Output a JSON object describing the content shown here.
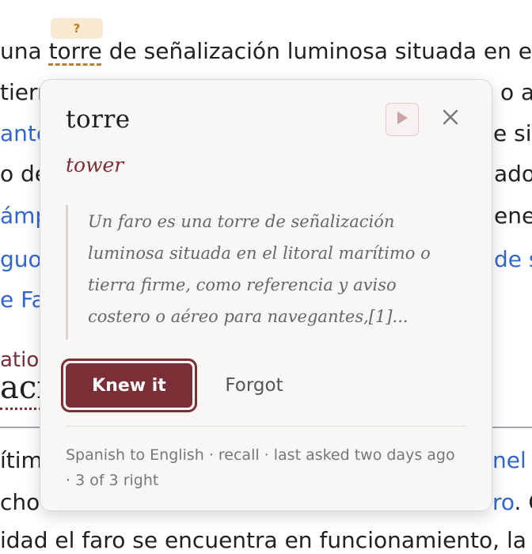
{
  "article": {
    "line1_pre": "una ",
    "line1_word": "torre",
    "line1_post": " de señalización luminosa situada en e",
    "line2_left": "tierr",
    "line2_right": "o a",
    "line3_left": "ante",
    "line3_right": "e sir",
    "line4_left": "o de",
    "line4_right": "ado",
    "line5_left": "ámp",
    "line5_right": "ene",
    "line6_left": "guo",
    "line6_right": "de s",
    "line7_left": "e Fa",
    "line8_left": "atio",
    "line9_left": "aci",
    "line10_left": "ítime",
    "line10_right": "nel c",
    "line11_left": "cho",
    "line11_right_link": "ro",
    "line11_right_tail": ". C",
    "line12": "idad el faro se encuentra en funcionamiento, la"
  },
  "badge": {
    "label": "?"
  },
  "card": {
    "word": "torre",
    "translation": "tower",
    "quote": "Un faro es una torre de señalización luminosa situada en el litoral marítimo o tierra firme, como referencia y aviso costero o aéreo para navegantes,[1]...",
    "knew_label": "Knew it",
    "forgot_label": "Forgot",
    "meta": "Spanish to English · recall · last asked two days ago · 3 of 3 right",
    "icons": {
      "play": "play-icon",
      "close": "close-icon"
    }
  },
  "colors": {
    "accent": "#7a2e35",
    "link": "#3366cc",
    "highlight": "#f9e8d2"
  }
}
